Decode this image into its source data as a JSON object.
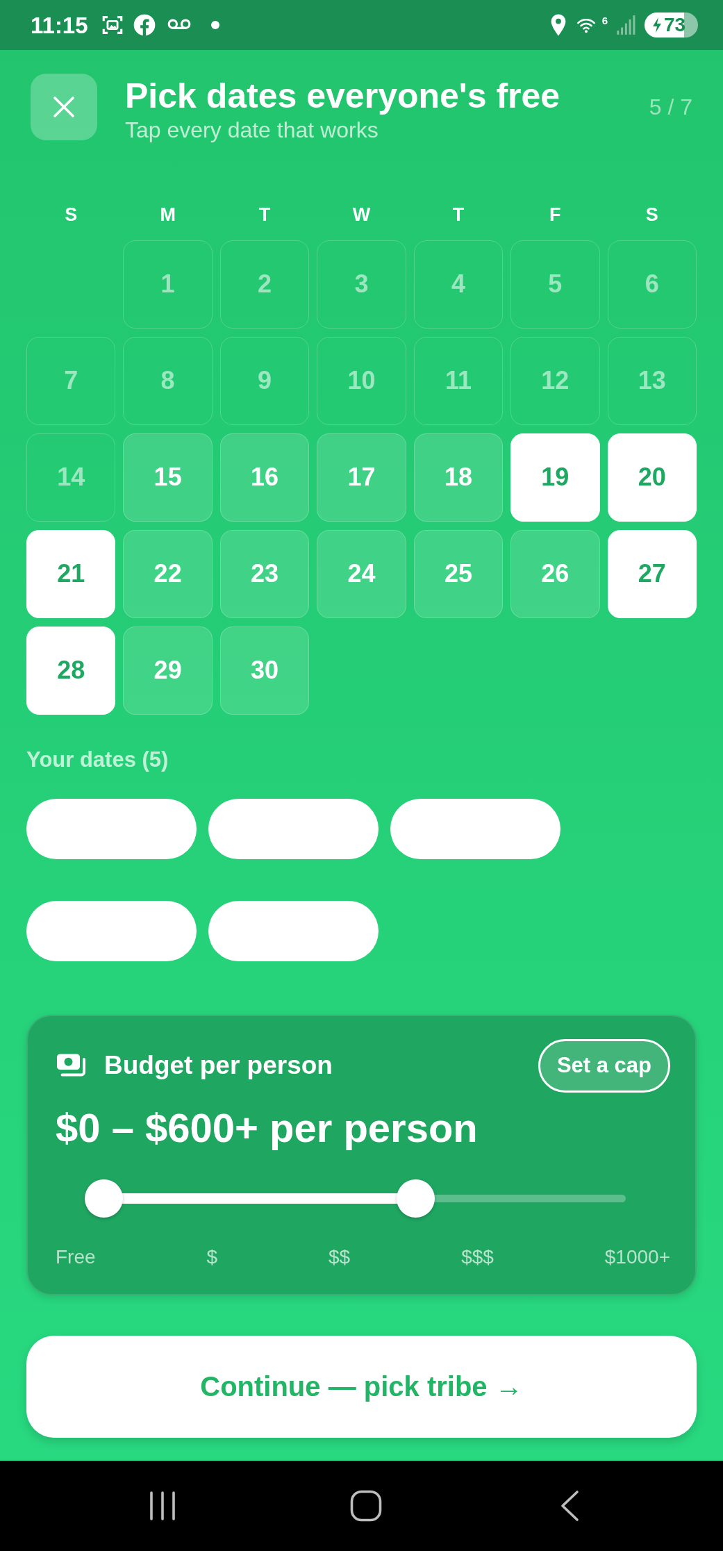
{
  "status_bar": {
    "time": "11:15",
    "wifi_label": "6",
    "battery": "73"
  },
  "header": {
    "title": "Pick dates everyone's free",
    "subtitle": "Tap every date that works",
    "step": "5 / 7"
  },
  "calendar": {
    "weekdays": [
      "S",
      "M",
      "T",
      "W",
      "T",
      "F",
      "S"
    ],
    "weeks": [
      [
        {
          "label": "1",
          "disabled": true,
          "selected": false
        },
        {
          "label": "2",
          "disabled": true,
          "selected": false
        },
        {
          "label": "3",
          "disabled": true,
          "selected": false
        },
        {
          "label": "4",
          "disabled": true,
          "selected": false
        },
        {
          "label": "5",
          "disabled": true,
          "selected": false
        },
        {
          "label": "6",
          "disabled": true,
          "selected": false
        }
      ],
      [
        {
          "label": "7",
          "disabled": true,
          "selected": false
        },
        {
          "label": "8",
          "disabled": true,
          "selected": false
        },
        {
          "label": "9",
          "disabled": true,
          "selected": false
        },
        {
          "label": "10",
          "disabled": true,
          "selected": false
        },
        {
          "label": "11",
          "disabled": true,
          "selected": false
        },
        {
          "label": "12",
          "disabled": true,
          "selected": false
        },
        {
          "label": "13",
          "disabled": true,
          "selected": false
        }
      ],
      [
        {
          "label": "14",
          "disabled": true,
          "selected": false
        },
        {
          "label": "15",
          "disabled": false,
          "selected": false
        },
        {
          "label": "16",
          "disabled": false,
          "selected": false
        },
        {
          "label": "17",
          "disabled": false,
          "selected": false
        },
        {
          "label": "18",
          "disabled": false,
          "selected": false
        },
        {
          "label": "19",
          "disabled": false,
          "selected": true
        },
        {
          "label": "20",
          "disabled": false,
          "selected": true
        }
      ],
      [
        {
          "label": "21",
          "disabled": false,
          "selected": true
        },
        {
          "label": "22",
          "disabled": false,
          "selected": false
        },
        {
          "label": "23",
          "disabled": false,
          "selected": false
        },
        {
          "label": "24",
          "disabled": false,
          "selected": false
        },
        {
          "label": "25",
          "disabled": false,
          "selected": false
        },
        {
          "label": "26",
          "disabled": false,
          "selected": false
        },
        {
          "label": "27",
          "disabled": false,
          "selected": true
        }
      ],
      [
        {
          "label": "28",
          "disabled": false,
          "selected": true
        },
        {
          "label": "29",
          "disabled": false,
          "selected": false
        },
        {
          "label": "30",
          "disabled": false,
          "selected": false
        }
      ]
    ]
  },
  "your_dates": {
    "label": "Your dates (5)",
    "chips": [
      {
        "kind": "blank"
      },
      {
        "kind": "blank"
      },
      {
        "kind": "blank"
      },
      {
        "kind": "blank"
      },
      {
        "kind": "blank"
      }
    ]
  },
  "budget": {
    "title": "Budget per person",
    "cap_button": "Set a cap",
    "range": "$0 – $600+ per person",
    "slider": {
      "thumbs": [
        {
          "level": 0
        },
        {
          "level": 0.62
        }
      ]
    },
    "ticks": [
      "Free",
      "$",
      "$$",
      "$$$",
      "$1000+"
    ]
  },
  "continue_button": "Continue — pick tribe →"
}
